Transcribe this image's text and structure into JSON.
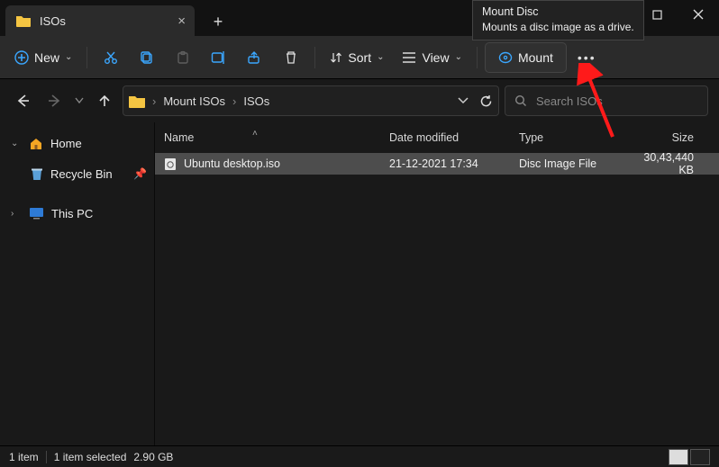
{
  "window": {
    "tab_title": "ISOs",
    "tooltip_title": "Mount Disc",
    "tooltip_body": "Mounts a disc image as a drive."
  },
  "toolbar": {
    "new_label": "New",
    "sort_label": "Sort",
    "view_label": "View",
    "mount_label": "Mount"
  },
  "nav": {
    "breadcrumb": [
      "Mount ISOs",
      "ISOs"
    ],
    "search_placeholder": "Search ISOs"
  },
  "sidebar": {
    "home_label": "Home",
    "recycle_label": "Recycle Bin",
    "thispc_label": "This PC"
  },
  "columns": {
    "name": "Name",
    "date": "Date modified",
    "type": "Type",
    "size": "Size"
  },
  "files": [
    {
      "name": "Ubuntu desktop.iso",
      "date": "21-12-2021 17:34",
      "type": "Disc Image File",
      "size": "30,43,440 KB"
    }
  ],
  "status": {
    "count": "1 item",
    "selected": "1 item selected",
    "sel_size": "2.90 GB"
  }
}
